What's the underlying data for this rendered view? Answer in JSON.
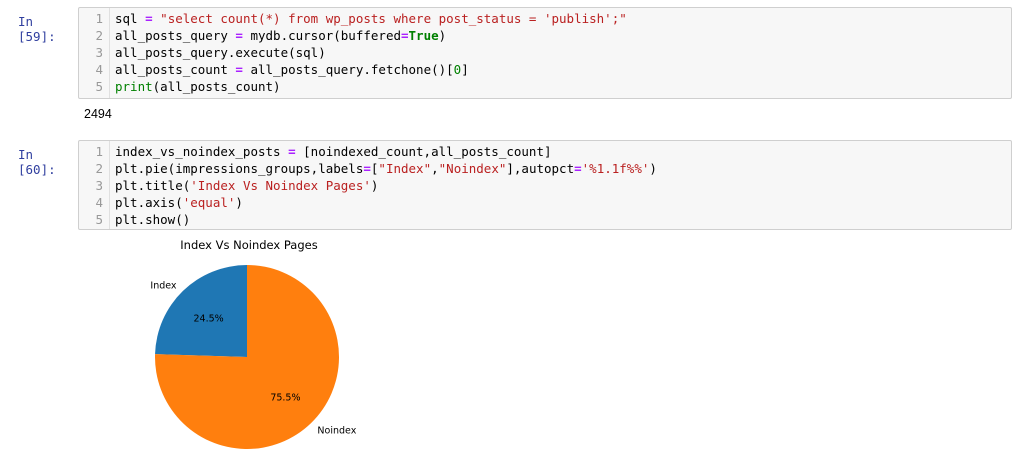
{
  "cells": [
    {
      "prompt": "In [59]:",
      "lines": [
        {
          "num": "1",
          "parts": [
            [
              "n",
              "sql "
            ],
            [
              "o",
              "="
            ],
            [
              "s",
              " \"select count(*) from wp_posts where post_status = 'publish';\""
            ]
          ]
        },
        {
          "num": "2",
          "parts": [
            [
              "n",
              "all_posts_query "
            ],
            [
              "o",
              "="
            ],
            [
              "n",
              " mydb.cursor(buffered"
            ],
            [
              "o",
              "="
            ],
            [
              "k",
              "True"
            ],
            [
              "n",
              ")"
            ]
          ]
        },
        {
          "num": "3",
          "parts": [
            [
              "n",
              "all_posts_query.execute(sql)"
            ]
          ]
        },
        {
          "num": "4",
          "parts": [
            [
              "n",
              "all_posts_count "
            ],
            [
              "o",
              "="
            ],
            [
              "n",
              " all_posts_query.fetchone()["
            ],
            [
              "m",
              "0"
            ],
            [
              "n",
              "]"
            ]
          ]
        },
        {
          "num": "5",
          "parts": [
            [
              "b",
              "print"
            ],
            [
              "n",
              "(all_posts_count)"
            ]
          ]
        }
      ],
      "output": "2494"
    },
    {
      "prompt": "In [60]:",
      "lines": [
        {
          "num": "1",
          "parts": [
            [
              "n",
              "index_vs_noindex_posts "
            ],
            [
              "o",
              "="
            ],
            [
              "n",
              " [noindexed_count,all_posts_count]"
            ]
          ]
        },
        {
          "num": "2",
          "parts": [
            [
              "n",
              "plt.pie(impressions_groups,labels"
            ],
            [
              "o",
              "="
            ],
            [
              "n",
              "["
            ],
            [
              "s",
              "\"Index\""
            ],
            [
              "n",
              ","
            ],
            [
              "s",
              "\"Noindex\""
            ],
            [
              "n",
              "],autopct"
            ],
            [
              "o",
              "="
            ],
            [
              "s",
              "'%1.1f%%'"
            ],
            [
              "n",
              ")"
            ]
          ]
        },
        {
          "num": "3",
          "parts": [
            [
              "n",
              "plt.title("
            ],
            [
              "s",
              "'Index Vs Noindex Pages'"
            ],
            [
              "n",
              ")"
            ]
          ]
        },
        {
          "num": "4",
          "parts": [
            [
              "n",
              "plt.axis("
            ],
            [
              "s",
              "'equal'"
            ],
            [
              "n",
              ")"
            ]
          ]
        },
        {
          "num": "5",
          "parts": [
            [
              "n",
              "plt.show()"
            ]
          ]
        }
      ]
    }
  ],
  "chart_data": {
    "type": "pie",
    "title": "Index Vs Noindex Pages",
    "labels": [
      "Index",
      "Noindex"
    ],
    "values": [
      24.5,
      75.5
    ],
    "pct_labels": [
      "24.5%",
      "75.5%"
    ],
    "colors": [
      "#1f77b4",
      "#ff7f0e"
    ]
  }
}
